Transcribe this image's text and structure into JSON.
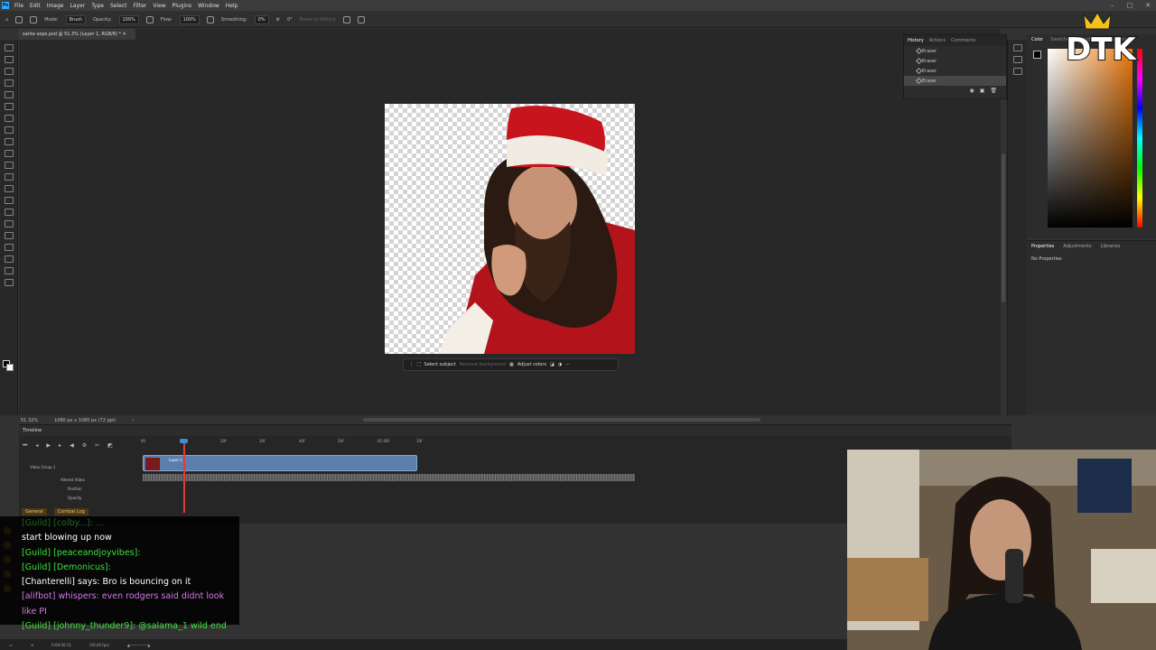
{
  "menu": {
    "app_icon": "Ps",
    "items": [
      "File",
      "Edit",
      "Image",
      "Layer",
      "Type",
      "Select",
      "Filter",
      "View",
      "Plugins",
      "Window",
      "Help"
    ]
  },
  "options": {
    "mode_label": "Mode:",
    "mode_value": "Brush",
    "opacity_label": "Opacity:",
    "opacity_value": "100%",
    "flow_label": "Flow:",
    "flow_value": "100%",
    "smoothing_label": "Smoothing:",
    "smoothing_value": "0%",
    "angle_value": "0°",
    "erase_history": "Erase to History"
  },
  "document": {
    "tab_title": "santa oops.psd @ 51.3% (Layer 1, RGB/8) *",
    "zoom": "51.32%",
    "size": "1080 px x 1080 px (72 ppi)"
  },
  "context_bar": {
    "select_subject": "Select subject",
    "remove_bg": "Remove background",
    "adjust_colors": "Adjust colors"
  },
  "history": {
    "tabs": [
      "History",
      "Actions",
      "Comments"
    ],
    "items": [
      "Eraser",
      "Eraser",
      "Eraser",
      "Eraser"
    ]
  },
  "color_panel": {
    "tabs": [
      "Color",
      "Swatches",
      "Gradients",
      "Patterns"
    ]
  },
  "properties": {
    "tabs": [
      "Properties",
      "Adjustments",
      "Libraries"
    ],
    "empty": "No Properties"
  },
  "timeline": {
    "title": "Timeline",
    "ruler": [
      "00",
      "10f",
      "20f",
      "30f",
      "40f",
      "50f",
      "01:00f",
      "10f"
    ],
    "group": "Video Group 1",
    "layer": "Layer 1",
    "rows": [
      "Altered Video",
      "Position",
      "Opacity"
    ],
    "timecode": "0:00:00:11",
    "fps": "(30.00 fps)"
  },
  "chat": {
    "tabs": [
      "General",
      "Combat Log"
    ],
    "lines": [
      {
        "type": "g",
        "text": "[Guild] [colby...]: ..."
      },
      {
        "type": "plain",
        "text": "start blowing up now"
      },
      {
        "type": "g",
        "text": "[Guild] [peaceandjoyvibes]:"
      },
      {
        "type": "g",
        "text": "[Guild] [Demonicus]:"
      },
      {
        "type": "plain",
        "text": "[Chanterelli] says:  Bro is bouncing on it"
      },
      {
        "type": "w",
        "text": "[alifbot] whispers:  even rodgers said didnt look"
      },
      {
        "type": "w",
        "text": "like PI"
      },
      {
        "type": "g",
        "text": "[Guild] [johnny_thunder9]:  @salama_1 wild end"
      }
    ]
  },
  "overlay": {
    "logo": "DTK"
  }
}
